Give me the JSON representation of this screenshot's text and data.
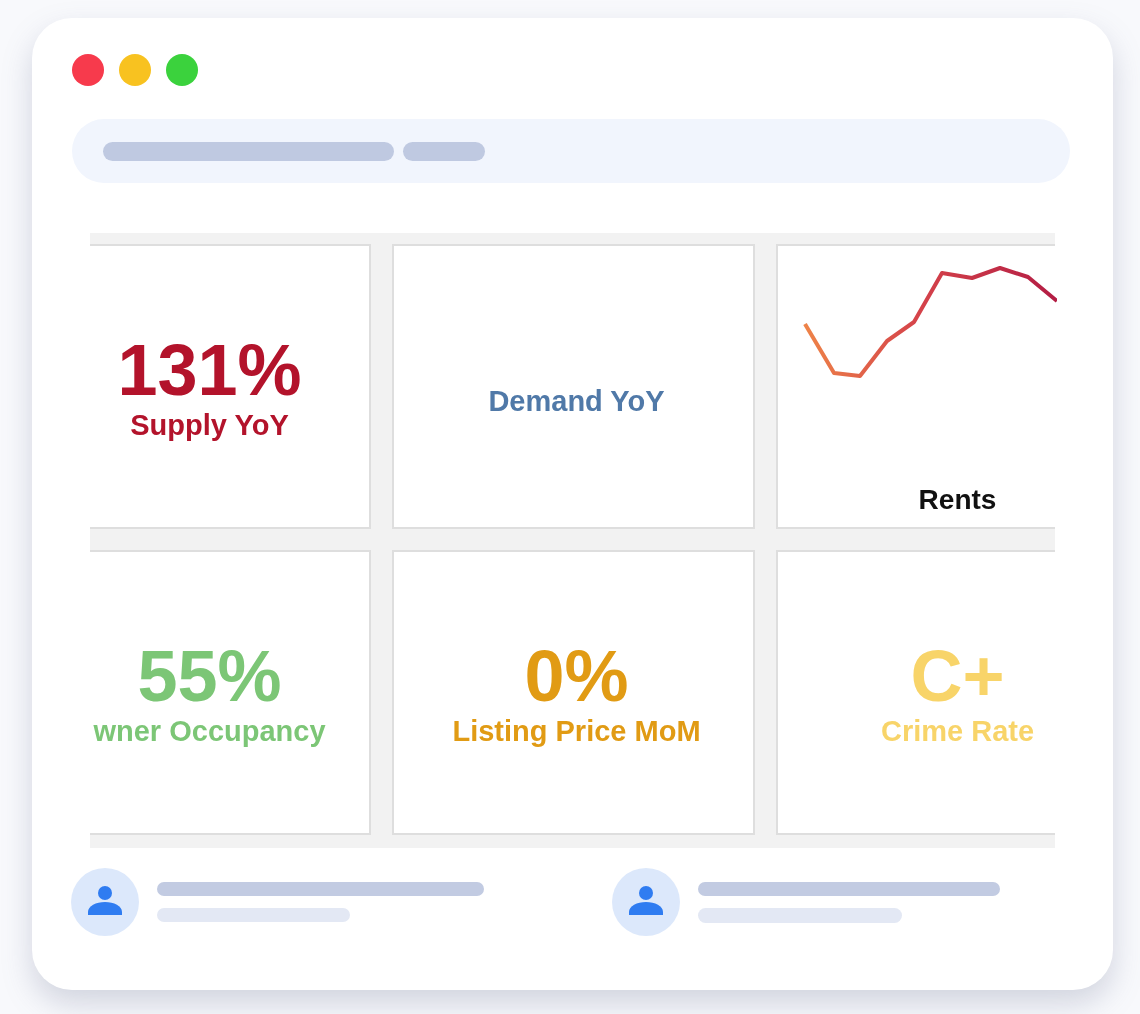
{
  "window": {
    "controls": [
      {
        "color": "#f73a4c"
      },
      {
        "color": "#f8c220"
      },
      {
        "color": "#3bd23d"
      }
    ]
  },
  "dashboard": {
    "tiles": [
      {
        "kind": "stat",
        "value": "131%",
        "label": "Supply YoY",
        "color": "#b3132b"
      },
      {
        "kind": "label",
        "label": "Demand YoY",
        "color": "#5079a8"
      },
      {
        "kind": "sparkline",
        "label": "Rents",
        "color": "#111111"
      },
      {
        "kind": "stat",
        "value": "55%",
        "label": "wner Occupancy",
        "color": "#7cc676"
      },
      {
        "kind": "stat",
        "value": "0%",
        "label": "Listing Price MoM",
        "color": "#e19b14"
      },
      {
        "kind": "stat",
        "value": "C+",
        "label": "Crime Rate",
        "color": "#f8d469"
      }
    ]
  }
}
